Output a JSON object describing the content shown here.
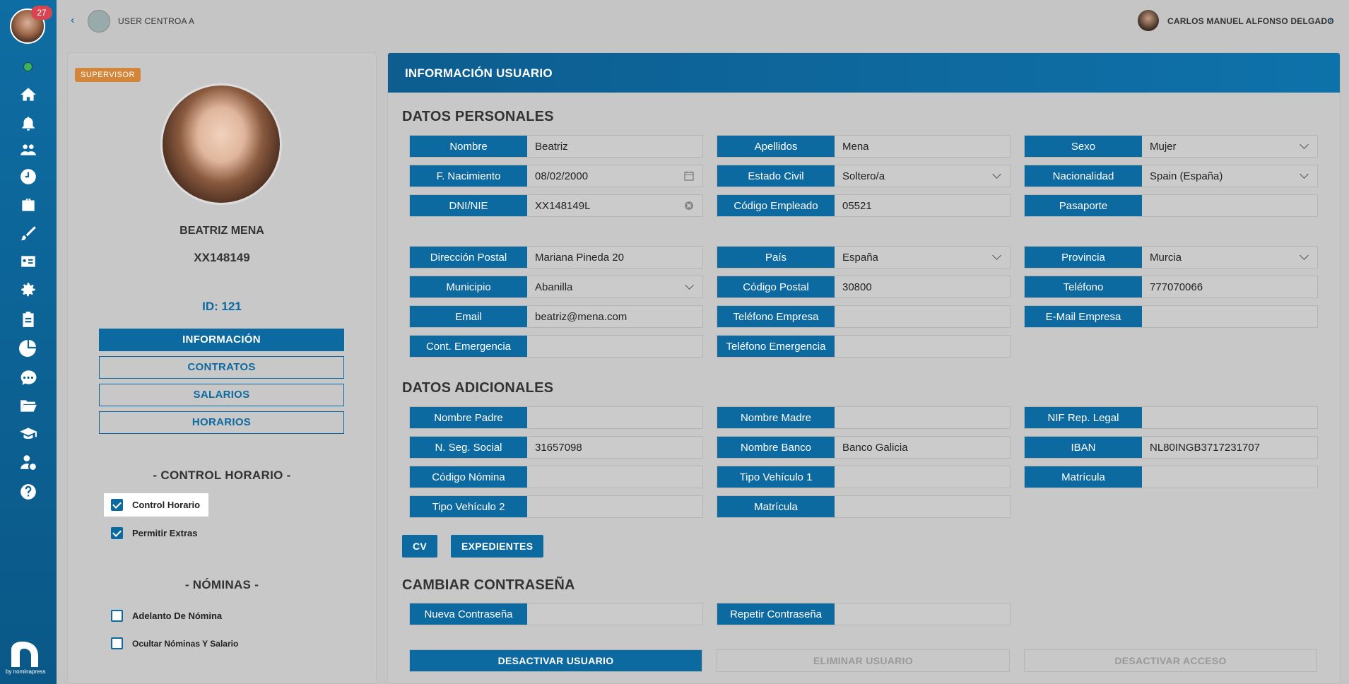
{
  "sidebar": {
    "notifications_count": "27",
    "nav_icons": [
      "home-icon",
      "bell-icon",
      "team-icon",
      "clock-icon",
      "briefcase-icon",
      "paint-brush-icon",
      "id-card-icon",
      "gear-icon",
      "clipboard-icon",
      "pie-chart-icon",
      "chat-icon",
      "folder-icon",
      "graduation-cap-icon",
      "user-dollar-icon",
      "help-icon"
    ],
    "brand_text": "by nominapress"
  },
  "topbar": {
    "back_symbol": "‹",
    "title": "USER CENTROA A",
    "user_name": "CARLOS MANUEL ALFONSO DELGADO",
    "next_symbol": "›"
  },
  "profile": {
    "role_badge": "SUPERVISOR",
    "name": "BEATRIZ MENA",
    "document": "XX148149",
    "id_label": "ID: 121",
    "tabs": [
      "INFORMACIÓN",
      "CONTRATOS",
      "SALARIOS",
      "HORARIOS"
    ],
    "control_horario_title": "- CONTROL HORARIO -",
    "control_horario_options": [
      {
        "label": "Control Horario",
        "checked": true
      },
      {
        "label": "Permitir Extras",
        "checked": true
      }
    ],
    "nominas_title": "- NÓMINAS -",
    "nominas_options": [
      {
        "label": "Adelanto De Nómina",
        "checked": false
      },
      {
        "label": "Ocultar Nóminas Y Salario",
        "checked": false
      }
    ]
  },
  "main": {
    "header": "INFORMACIÓN USUARIO",
    "personal_title": "DATOS PERSONALES",
    "personal": [
      {
        "label": "Nombre",
        "value": "Beatriz"
      },
      {
        "label": "Apellidos",
        "value": "Mena"
      },
      {
        "label": "Sexo",
        "value": "Mujer"
      },
      {
        "label": "F. Nacimiento",
        "value": "08/02/2000"
      },
      {
        "label": "Estado Civil",
        "value": "Soltero/a"
      },
      {
        "label": "Nacionalidad",
        "value": "Spain (España)"
      },
      {
        "label": "DNI/NIE",
        "value": "XX148149L"
      },
      {
        "label": "Código Empleado",
        "value": "05521"
      },
      {
        "label": "Pasaporte",
        "value": ""
      },
      {
        "label": "Dirección Postal",
        "value": "Mariana Pineda 20"
      },
      {
        "label": "País",
        "value": "España"
      },
      {
        "label": "Provincia",
        "value": "Murcia"
      },
      {
        "label": "Municipio",
        "value": "Abanilla"
      },
      {
        "label": "Código Postal",
        "value": "30800"
      },
      {
        "label": "Teléfono",
        "value": "777070066"
      },
      {
        "label": "Email",
        "value": "beatriz@mena.com"
      },
      {
        "label": "Teléfono Empresa",
        "value": ""
      },
      {
        "label": "E-Mail Empresa",
        "value": ""
      },
      {
        "label": "Cont. Emergencia",
        "value": ""
      },
      {
        "label": "Teléfono Emergencia",
        "value": ""
      }
    ],
    "additional_title": "DATOS ADICIONALES",
    "additional": [
      {
        "label": "Nombre Padre",
        "value": ""
      },
      {
        "label": "Nombre Madre",
        "value": ""
      },
      {
        "label": "NIF Rep. Legal",
        "value": ""
      },
      {
        "label": "N. Seg. Social",
        "value": "31657098"
      },
      {
        "label": "Nombre Banco",
        "value": "Banco Galicia"
      },
      {
        "label": "IBAN",
        "value": "NL80INGB3717231707"
      },
      {
        "label": "Código Nómina",
        "value": ""
      },
      {
        "label": "Tipo Vehículo 1",
        "value": ""
      },
      {
        "label": "Matrícula",
        "value": ""
      },
      {
        "label": "Tipo Vehículo 2",
        "value": ""
      },
      {
        "label": "Matrícula",
        "value": ""
      }
    ],
    "cv_label": "CV",
    "expedientes_label": "EXPEDIENTES",
    "password_title": "CAMBIAR CONTRASEÑA",
    "password": [
      {
        "label": "Nueva Contraseña",
        "value": ""
      },
      {
        "label": "Repetir Contraseña",
        "value": ""
      }
    ],
    "actions": [
      "DESACTIVAR USUARIO",
      "ELIMINAR USUARIO",
      "DESACTIVAR ACCESO"
    ]
  }
}
